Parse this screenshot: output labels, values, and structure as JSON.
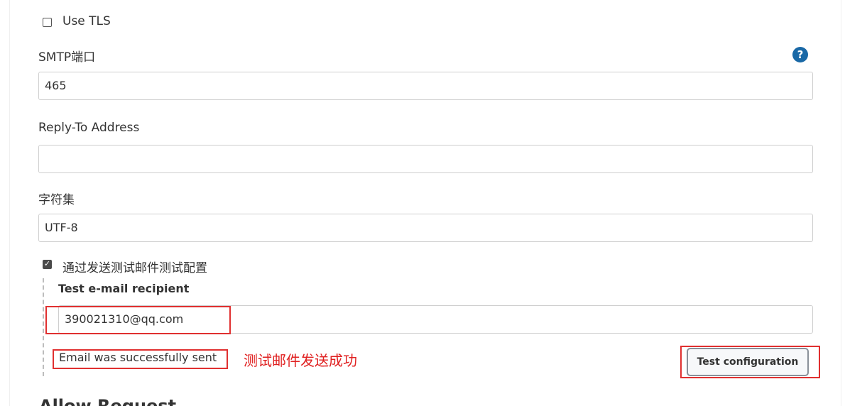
{
  "use_tls": {
    "label": "Use TLS",
    "checked": false
  },
  "smtp_port": {
    "label": "SMTP端口",
    "value": "465",
    "help_icon": "question-circle-icon"
  },
  "reply_to": {
    "label": "Reply-To Address",
    "value": ""
  },
  "charset": {
    "label": "字符集",
    "value": "UTF-8"
  },
  "test_config": {
    "checkbox_label": "通过发送测试邮件测试配置",
    "checked": true,
    "recipient_label": "Test e-mail recipient",
    "recipient_value": "390021310@qq.com",
    "status": "Email was successfully sent",
    "annotation": "测试邮件发送成功",
    "button_label": "Test configuration"
  },
  "next_section_title": "Allow Request",
  "colors": {
    "annotation_red": "#e03030",
    "help_blue": "#1968a6"
  }
}
